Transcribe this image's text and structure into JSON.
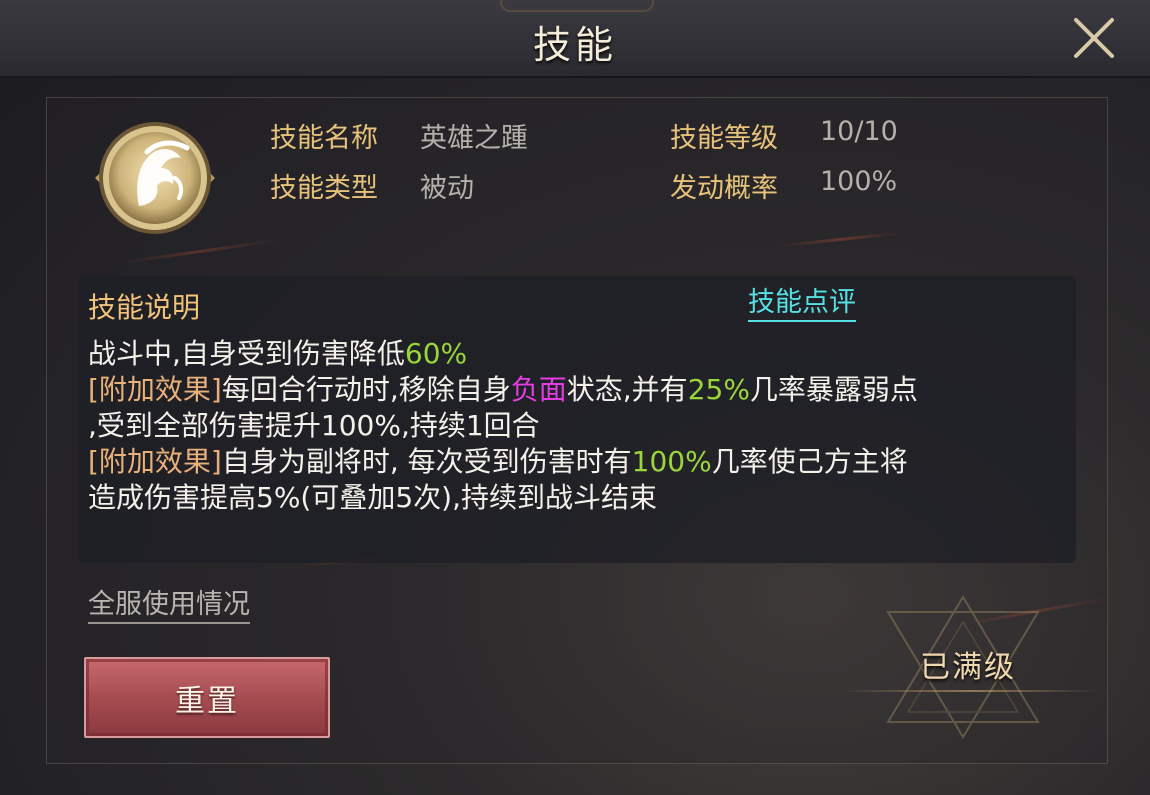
{
  "header": {
    "title": "技能"
  },
  "skill": {
    "icon": "hero-helmet-icon",
    "name_label": "技能名称",
    "name_value": "英雄之踵",
    "level_label": "技能等级",
    "level_value": "10/10",
    "type_label": "技能类型",
    "type_value": "被动",
    "chance_label": "发动概率",
    "chance_value": "100%"
  },
  "description": {
    "title": "技能说明",
    "review_link": "技能点评",
    "line1": {
      "text": "战斗中,自身受到伤害降低",
      "pct": "60%"
    },
    "line2": {
      "tag": "[附加效果]",
      "a": "每回合行动时,移除自身",
      "neg": "负面",
      "b": "状态,并有",
      "pct": "25%",
      "c": "几率暴露弱点"
    },
    "line3": {
      "text": ",受到全部伤害提升100%,持续1回合"
    },
    "line4": {
      "tag": "[附加效果]",
      "a": "自身为副将时, 每次受到伤害时有",
      "pct": "100%",
      "b": "几率使己方主将"
    },
    "line5": {
      "text": "造成伤害提高5%(可叠加5次),持续到战斗结束"
    }
  },
  "footer": {
    "usage_link": "全服使用情况",
    "reset_button": "重置",
    "maxed_label": "已满级"
  },
  "colors": {
    "label_gold": "#e7c27a",
    "highlight_green": "#9ad63a",
    "highlight_magenta": "#e33de3",
    "link_cyan": "#56e0e4",
    "button_red": "#a34a4f"
  }
}
